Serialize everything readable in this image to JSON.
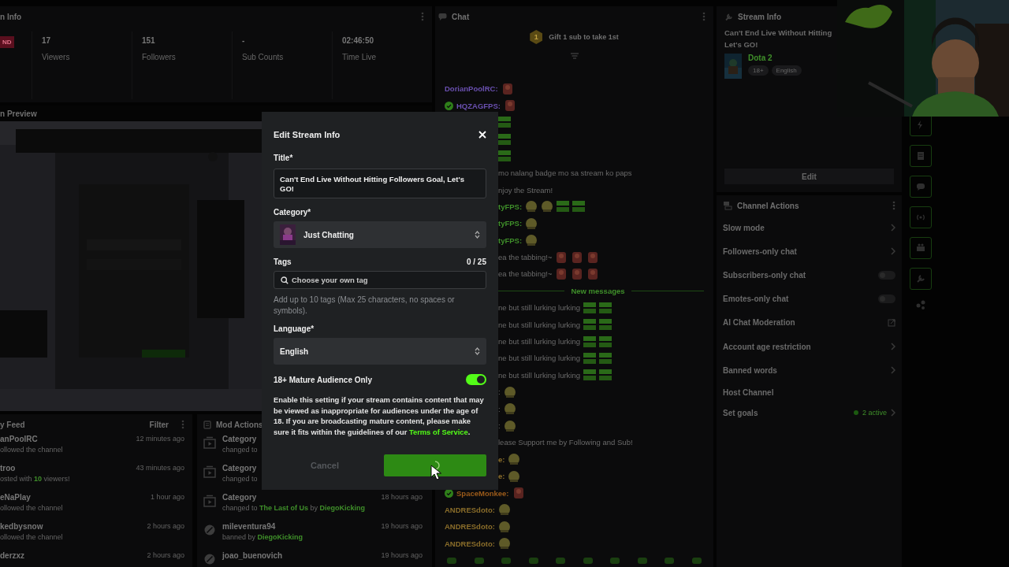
{
  "stream_info": {
    "title": "n Info",
    "live_badge": "ND",
    "stats": [
      {
        "value": "17",
        "label": "Viewers"
      },
      {
        "value": "151",
        "label": "Followers"
      },
      {
        "value": "-",
        "label": "Sub Counts"
      },
      {
        "value": "02:46:50",
        "label": "Time Live"
      }
    ]
  },
  "preview": {
    "title": "n Preview"
  },
  "activity_feed": {
    "title": "y Feed",
    "filter": "Filter",
    "items": [
      {
        "name": "anPoolRC",
        "detail": "ollowed the channel",
        "time": "12 minutes ago"
      },
      {
        "name": "troo",
        "detail": "osted with **10** viewers!",
        "time": "43 minutes ago"
      },
      {
        "name": "eNaPlay",
        "detail": "ollowed the channel",
        "time": "1 hour ago"
      },
      {
        "name": "kedbysnow",
        "detail": "ollowed the channel",
        "time": "2 hours ago"
      },
      {
        "name": "derzxz",
        "time": "2 hours ago"
      }
    ]
  },
  "mod_actions": {
    "title": "Mod Actions",
    "items": [
      {
        "kind": "category",
        "name": "Category",
        "detail": "changed to"
      },
      {
        "kind": "category",
        "name": "Category",
        "detail": "changed to"
      },
      {
        "kind": "category",
        "name": "Category",
        "detail": "changed to **The Last of Us** by **DiegoKicking**",
        "time": "18 hours ago"
      },
      {
        "kind": "ban",
        "name": "mileventura94",
        "detail": "banned by **DiegoKicking**",
        "time": "19 hours ago"
      },
      {
        "kind": "ban",
        "name": "joao_buenovich",
        "time": "19 hours ago"
      }
    ]
  },
  "chat": {
    "title": "Chat",
    "pinned": {
      "rank": "1",
      "text": "Gift 1 sub to take 1st"
    },
    "messages": [
      {
        "kind": "full",
        "name": "DorianPoolRC:",
        "color": "#6a50b0",
        "verified": false,
        "emotes": [
          {
            "kind": "art"
          }
        ]
      },
      {
        "kind": "full",
        "name": "HQZAGFPS:",
        "color": "#6a50b0",
        "verified": true,
        "emotes": [
          {
            "kind": "art"
          }
        ]
      },
      {
        "kind": "partial",
        "emotes": [
          {
            "kind": "logo"
          }
        ]
      },
      {
        "kind": "partial",
        "emotes": [
          {
            "kind": "logo"
          }
        ]
      },
      {
        "kind": "partial",
        "emotes": [
          {
            "kind": "logo"
          }
        ]
      },
      {
        "kind": "partial",
        "text": "mo nalang badge mo sa stream ko paps"
      },
      {
        "kind": "partial",
        "text": "njoy the Stream!"
      },
      {
        "kind": "partial",
        "name": "tyFPS:",
        "color": "#3f8f2a",
        "emotes": [
          {
            "kind": "face"
          },
          {
            "kind": "face"
          },
          {
            "kind": "logo"
          },
          {
            "kind": "logo"
          }
        ]
      },
      {
        "kind": "partial",
        "name": "tyFPS:",
        "color": "#3f8f2a",
        "emotes": [
          {
            "kind": "face"
          }
        ]
      },
      {
        "kind": "partial",
        "name": "tyFPS:",
        "color": "#3f8f2a",
        "emotes": [
          {
            "kind": "face"
          }
        ]
      },
      {
        "kind": "partial",
        "text": "ea the tabbing!~",
        "emotes": [
          {
            "kind": "art"
          },
          {
            "kind": "art"
          },
          {
            "kind": "art"
          }
        ]
      },
      {
        "kind": "partial",
        "text": "ea the tabbing!~",
        "emotes": [
          {
            "kind": "art"
          },
          {
            "kind": "art"
          },
          {
            "kind": "art"
          }
        ]
      },
      {
        "kind": "divider",
        "text": "New messages"
      },
      {
        "kind": "partial",
        "text": "ne but still lurking lurking",
        "emotes": [
          {
            "kind": "logo"
          },
          {
            "kind": "logo"
          }
        ]
      },
      {
        "kind": "partial",
        "text": "ne but still lurking lurking",
        "emotes": [
          {
            "kind": "logo"
          },
          {
            "kind": "logo"
          }
        ]
      },
      {
        "kind": "partial",
        "text": "ne but still lurking lurking",
        "emotes": [
          {
            "kind": "logo"
          },
          {
            "kind": "logo"
          }
        ]
      },
      {
        "kind": "partial",
        "text": "ne but still lurking lurking",
        "emotes": [
          {
            "kind": "logo"
          },
          {
            "kind": "logo"
          }
        ]
      },
      {
        "kind": "partial",
        "text": "ne but still lurking lurking",
        "emotes": [
          {
            "kind": "logo"
          },
          {
            "kind": "logo"
          }
        ]
      },
      {
        "kind": "partial",
        "text": ":",
        "emotes": [
          {
            "kind": "face"
          }
        ]
      },
      {
        "kind": "partial",
        "text": ":",
        "emotes": [
          {
            "kind": "face"
          }
        ]
      },
      {
        "kind": "partial",
        "text": ":",
        "emotes": [
          {
            "kind": "face"
          }
        ]
      },
      {
        "kind": "partial",
        "text": "lease Support me by Following and Sub!"
      },
      {
        "kind": "partial",
        "name": "e:",
        "color": "#8a6d2a",
        "emotes": [
          {
            "kind": "face"
          }
        ]
      },
      {
        "kind": "partial",
        "name": "e:",
        "color": "#8a6d2a",
        "emotes": [
          {
            "kind": "face"
          }
        ]
      },
      {
        "kind": "full",
        "name": "SpaceMonkee:",
        "color": "#9a5a1a",
        "verified": true,
        "emotes": [
          {
            "kind": "art"
          }
        ]
      },
      {
        "kind": "full",
        "name": "ANDRESdoto:",
        "color": "#8a6d2a",
        "verified": false,
        "emotes": [
          {
            "kind": "face"
          }
        ]
      },
      {
        "kind": "full",
        "name": "ANDRESdoto:",
        "color": "#8a6d2a",
        "verified": false,
        "emotes": [
          {
            "kind": "face"
          }
        ]
      },
      {
        "kind": "full",
        "name": "ANDRESdoto:",
        "color": "#8a6d2a",
        "verified": false,
        "emotes": [
          {
            "kind": "face"
          }
        ]
      }
    ]
  },
  "stream_panel": {
    "title": "Stream Info",
    "title_lines": [
      "Can't End Live Without Hitting",
      "Let's GO!"
    ],
    "category": "Dota 2",
    "tags": [
      "18+",
      "English"
    ],
    "edit": "Edit"
  },
  "channel_actions": {
    "title": "Channel Actions",
    "items": [
      {
        "kind": "link",
        "label": "Slow mode"
      },
      {
        "kind": "link",
        "label": "Followers-only chat"
      },
      {
        "kind": "toggle",
        "label": "Subscribers-only chat",
        "on": false
      },
      {
        "kind": "toggle",
        "label": "Emotes-only chat",
        "on": false
      },
      {
        "kind": "external",
        "label": "AI Chat Moderation"
      },
      {
        "kind": "link",
        "label": "Account age restriction"
      },
      {
        "kind": "link",
        "label": "Banned words"
      },
      {
        "kind": "plain",
        "label": "Host Channel"
      },
      {
        "kind": "link",
        "label": "Set goals",
        "status": "2 active"
      }
    ]
  },
  "modal": {
    "title": "Edit Stream Info",
    "title_label": "Title*",
    "title_value": "Can't End Live Without Hitting Followers Goal, Let's GO!",
    "category_label": "Category*",
    "category": "Just Chatting",
    "tags_label": "Tags",
    "tags_count": "0 / 25",
    "tags_placeholder": "Choose your own tag",
    "tags_help": "Add up to 10 tags (Max 25 characters, no spaces or symbols).",
    "language_label": "Language*",
    "language": "English",
    "mature": {
      "label": "18+ Mature Audience Only",
      "on": true
    },
    "notice": "Enable this setting if your stream contains content that may be viewed as inappropriate for audiences under the age of 18. If you are broadcasting mature content, please make sure it fits within the guidelines of our",
    "notice_link": "Terms of Service",
    "notice_end": ".",
    "cancel": "Cancel",
    "save_loading": true
  }
}
